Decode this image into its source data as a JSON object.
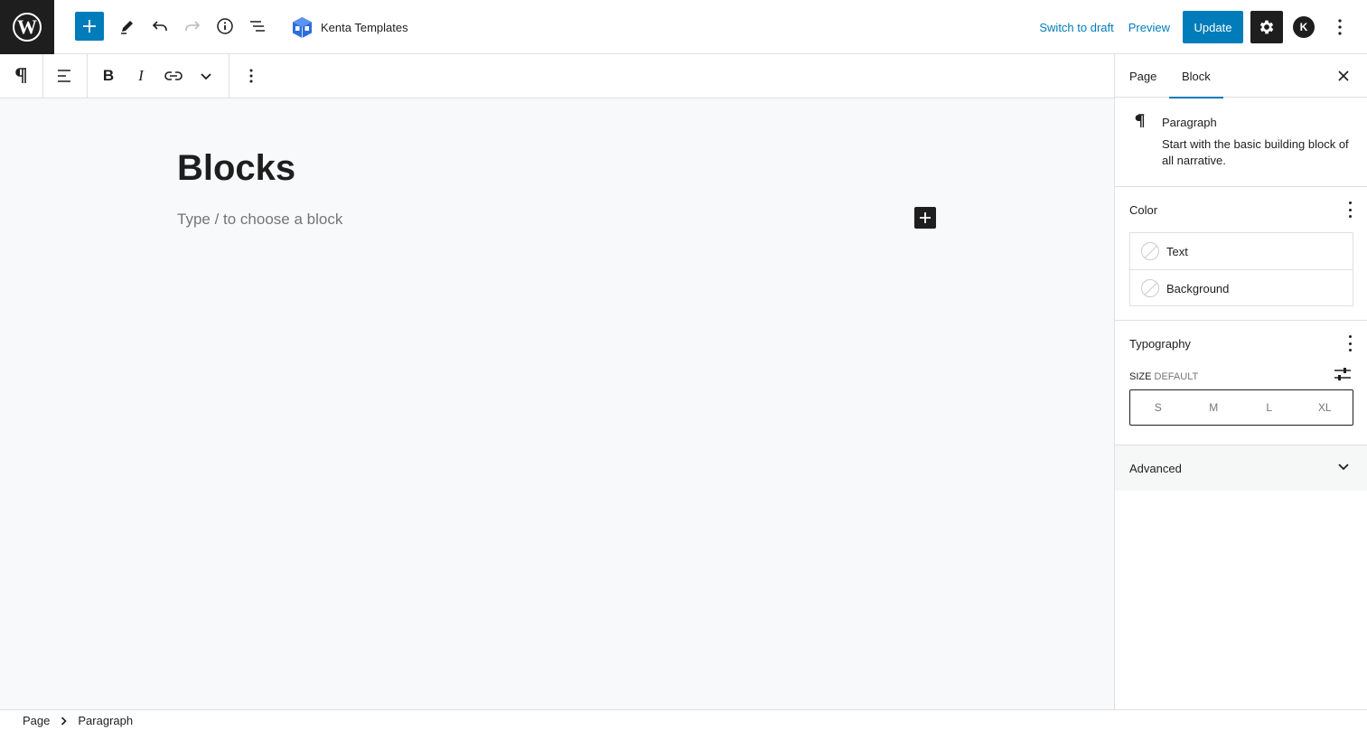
{
  "topbar": {
    "site_name": "Kenta Templates",
    "switch_to_draft": "Switch to draft",
    "preview": "Preview",
    "update": "Update",
    "avatar_initial": "K",
    "accent_color": "#007cba"
  },
  "icons": {
    "logo": "wordpress-logo",
    "add": "plus-icon",
    "tools": "pencil-icon",
    "undo": "undo-icon",
    "redo": "redo-icon",
    "details": "info-icon",
    "list_view": "list-view-icon",
    "settings": "gear-icon",
    "options": "vertical-ellipsis-icon"
  },
  "block_toolbar": {
    "items": [
      "paragraph-icon",
      "align-icon",
      "bold-icon",
      "italic-icon",
      "link-icon",
      "chevron-down-icon",
      "more-options-icon"
    ]
  },
  "editor": {
    "title": "Blocks",
    "placeholder": "Type / to choose a block"
  },
  "sidebar": {
    "tabs": [
      "Page",
      "Block"
    ],
    "active_tab": "Block",
    "block": {
      "name": "Paragraph",
      "description": "Start with the basic building block of all narrative."
    },
    "color": {
      "title": "Color",
      "items": [
        "Text",
        "Background"
      ]
    },
    "typography": {
      "title": "Typography",
      "size_label": "Size",
      "size_value": "Default",
      "sizes": [
        "S",
        "M",
        "L",
        "XL"
      ]
    },
    "advanced": {
      "title": "Advanced"
    }
  },
  "breadcrumb": [
    "Page",
    "Paragraph"
  ]
}
